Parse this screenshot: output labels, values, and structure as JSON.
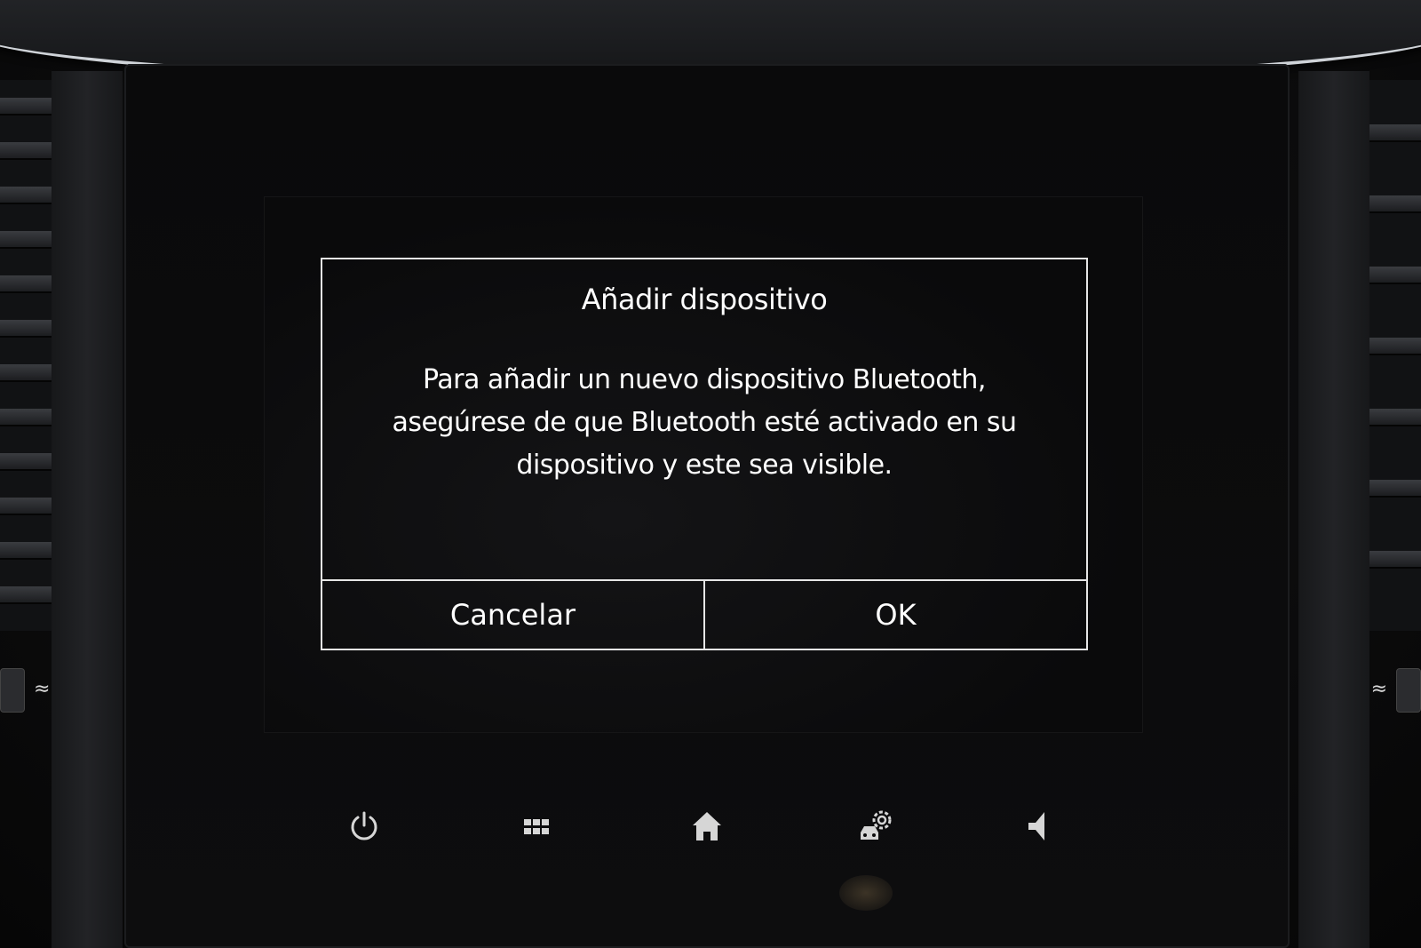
{
  "dialog": {
    "title": "Añadir dispositivo",
    "message": "Para añadir un nuevo dispositivo Bluetooth, asegúrese de que Bluetooth esté activado en su dispositivo y este sea visible.",
    "cancel_label": "Cancelar",
    "ok_label": "OK"
  },
  "hardware_buttons": [
    {
      "icon": "power-icon"
    },
    {
      "icon": "apps-grid-icon"
    },
    {
      "icon": "home-icon"
    },
    {
      "icon": "vehicle-settings-icon"
    },
    {
      "icon": "volume-icon"
    }
  ],
  "colors": {
    "text": "#ffffff",
    "border": "#e6e6e6",
    "screen_bg": "#0a0a0b",
    "icon": "#d6d6d6"
  }
}
